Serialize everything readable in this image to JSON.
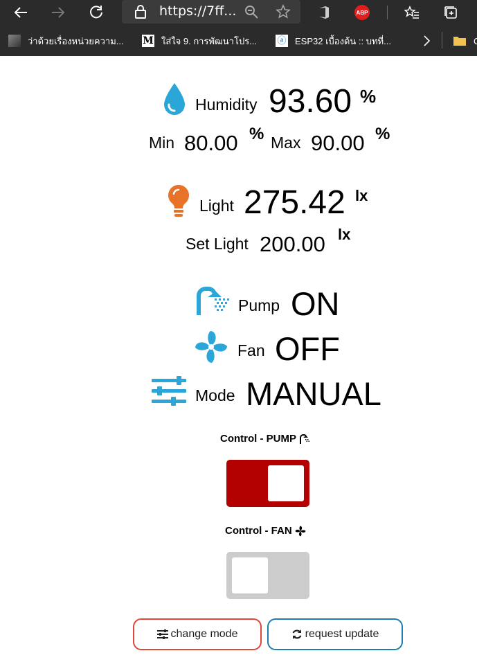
{
  "browser": {
    "url": "https://7ff...",
    "abp_badge": "ABP",
    "bookmarks": [
      {
        "label": "ว่าด้วยเรื่องหน่วยความ..."
      },
      {
        "label": "ใส่ใจ 9. การพัฒนาโปร..."
      },
      {
        "label": "ESP32 เบื้องต้น :: บทที่..."
      }
    ],
    "favicon_m": "M",
    "favicon_a": "ⓐ",
    "overflow_label": "C"
  },
  "humidity": {
    "label": "Humidity",
    "value": "93.60",
    "unit": "%",
    "min_label": "Min",
    "min_value": "80.00",
    "min_unit": "%",
    "max_label": "Max",
    "max_value": "90.00",
    "max_unit": "%"
  },
  "light": {
    "label": "Light",
    "value": "275.42",
    "unit": "lx",
    "set_label": "Set Light",
    "set_value": "200.00",
    "set_unit": "lx"
  },
  "pump": {
    "label": "Pump",
    "state": "ON"
  },
  "fan": {
    "label": "Fan",
    "state": "OFF"
  },
  "mode": {
    "label": "Mode",
    "state": "MANUAL"
  },
  "controls": {
    "pump_title": "Control - PUMP",
    "pump_on": true,
    "fan_title": "Control - FAN",
    "fan_on": false
  },
  "buttons": {
    "change_mode": "change mode",
    "request_update": "request update"
  },
  "colors": {
    "accent_blue": "#2ba6d8",
    "orange": "#e8722a",
    "switch_on": "#b30000",
    "switch_off": "#cccccc",
    "btn_red": "#e0453a",
    "btn_blue": "#1a7fb0"
  }
}
